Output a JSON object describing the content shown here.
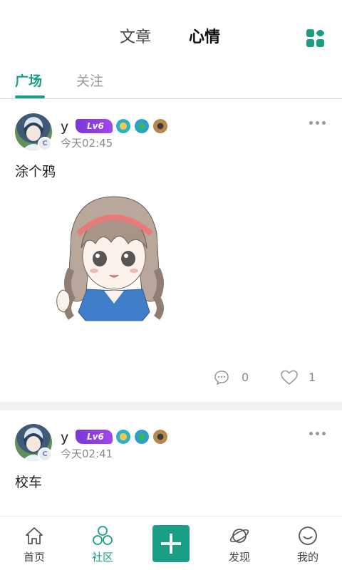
{
  "header": {
    "tabs": [
      {
        "label": "文章",
        "active": false
      },
      {
        "label": "心情",
        "active": true
      }
    ],
    "grid_icon": "grid-apps-icon"
  },
  "subtabs": [
    {
      "label": "广场",
      "active": true
    },
    {
      "label": "关注",
      "active": false
    }
  ],
  "accent_color": "#1a9e86",
  "posts": [
    {
      "username": "y",
      "level": "Lv6",
      "time": "今天02:45",
      "text": "涂个鸦",
      "has_image": true,
      "comment_count": "0",
      "like_count": "1",
      "avatar_badge": "C"
    },
    {
      "username": "y",
      "level": "Lv6",
      "time": "今天02:41",
      "text": "校车",
      "has_image": false,
      "avatar_badge": "C"
    }
  ],
  "bottom_nav": [
    {
      "label": "首页",
      "icon": "home-icon",
      "active": false
    },
    {
      "label": "社区",
      "icon": "community-icon",
      "active": true
    },
    {
      "label": "",
      "icon": "plus-icon",
      "active": false
    },
    {
      "label": "发现",
      "icon": "planet-icon",
      "active": false
    },
    {
      "label": "我的",
      "icon": "smiley-icon",
      "active": false
    }
  ]
}
